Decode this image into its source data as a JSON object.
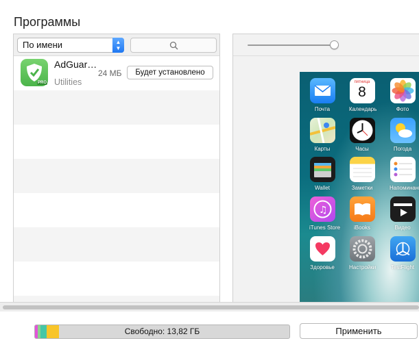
{
  "page": {
    "title": "Программы"
  },
  "left_panel": {
    "sort": {
      "value": "По имени",
      "icon": "up-down-arrows-icon"
    },
    "search": {
      "icon": "search-icon"
    },
    "apps": [
      {
        "name": "AdGuar…",
        "category": "Utilities",
        "size": "24 МБ",
        "action": "Будет установлено",
        "icon": "adguard-shield-icon",
        "badge": "PRO"
      }
    ]
  },
  "right_panel": {
    "zoom_slider": {
      "value": 0.95
    },
    "home_screen": [
      {
        "label": "Почта",
        "icon": "mail-icon"
      },
      {
        "label": "Календарь",
        "icon": "calendar-icon",
        "weekday": "пятница",
        "day": "8"
      },
      {
        "label": "Фото",
        "icon": "photos-icon"
      },
      {
        "label": "Карты",
        "icon": "maps-icon"
      },
      {
        "label": "Часы",
        "icon": "clock-icon"
      },
      {
        "label": "Погода",
        "icon": "weather-icon"
      },
      {
        "label": "Wallet",
        "icon": "wallet-icon"
      },
      {
        "label": "Заметки",
        "icon": "notes-icon"
      },
      {
        "label": "Напоминания",
        "icon": "reminders-icon"
      },
      {
        "label": "iTunes Store",
        "icon": "itunes-icon"
      },
      {
        "label": "iBooks",
        "icon": "ibooks-icon"
      },
      {
        "label": "Видео",
        "icon": "video-icon"
      },
      {
        "label": "Здоровье",
        "icon": "health-icon"
      },
      {
        "label": "Настройки",
        "icon": "settings-icon"
      },
      {
        "label": "TestFlight",
        "icon": "testflight-icon"
      }
    ]
  },
  "footer": {
    "storage_label": "Свободно: 13,82 ГБ",
    "storage_segments": [
      {
        "name": "pink",
        "color": "#e254d9",
        "fraction": 0.01
      },
      {
        "name": "green",
        "color": "#8ad48d",
        "fraction": 0.012
      },
      {
        "name": "teal",
        "color": "#46c7a6",
        "fraction": 0.025
      },
      {
        "name": "yellow",
        "color": "#f8c52a",
        "fraction": 0.048
      }
    ],
    "apply_label": "Применить"
  }
}
